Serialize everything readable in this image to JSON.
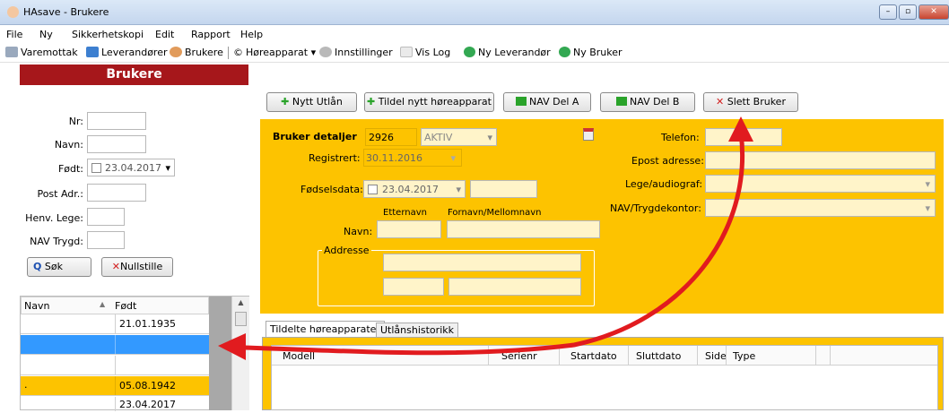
{
  "window": {
    "title": "HAsave - Brukere",
    "min": "–",
    "max": "▫",
    "close": "✕"
  },
  "menu": [
    "File",
    "Ny",
    "Sikkerhetskopi",
    "Edit",
    "Rapport",
    "Help"
  ],
  "toolbar": {
    "varemottak": "Varemottak",
    "leverandorer": "Leverandører",
    "brukere": "Brukere",
    "horeapparat": "Høreapparat",
    "innstillinger": "Innstillinger",
    "vislog": "Vis Log",
    "ny_leverandor": "Ny Leverandør",
    "ny_bruker": "Ny Bruker"
  },
  "search": {
    "header": "Brukere",
    "nr_label": "Nr:",
    "navn_label": "Navn:",
    "fodt_label": "Født:",
    "fodt_value": "23.04.2017",
    "post_label": "Post Adr.:",
    "lege_label": "Henv. Lege:",
    "nav_label": "NAV Trygd:",
    "sok_button": "Søk",
    "nullstille_button": "Nullstille"
  },
  "user_list": {
    "columns": [
      "Navn",
      "Født"
    ],
    "rows": [
      {
        "navn": "",
        "fodt": "21.01.1935"
      },
      {
        "navn": "",
        "fodt": ""
      },
      {
        "navn": "",
        "fodt": ""
      },
      {
        "navn": ".",
        "fodt": "05.08.1942"
      },
      {
        "navn": "",
        "fodt": "23.04.2017"
      }
    ]
  },
  "actions": {
    "nytt_utlan": "Nytt Utlån",
    "tildel": "Tildel nytt høreapparat",
    "nav_del_a": "NAV Del A",
    "nav_del_b": "NAV Del B",
    "slett_bruker": "Slett Bruker"
  },
  "details": {
    "title": "Bruker detaljer",
    "id": "2926",
    "status": "AKTIV",
    "registrert_label": "Registrert:",
    "registrert_value": "30.11.2016",
    "fodselsdata_label": "Fødselsdata:",
    "fodselsdata_value": "23.04.2017",
    "etternavn_label": "Etternavn",
    "fornavn_label": "Fornavn/Mellomnavn",
    "navn_label": "Navn:",
    "adresse_label": "Addresse",
    "telefon_label": "Telefon:",
    "epost_label": "Epost adresse:",
    "lege_label": "Lege/audiograf:",
    "nav_label": "NAV/Trygdekontor:"
  },
  "tabs": [
    "Tildelte høreapparater",
    "Utlånshistorikk"
  ],
  "devices": {
    "columns": [
      "Modell",
      "Serienr",
      "Startdato",
      "Sluttdato",
      "Side",
      "Type"
    ]
  },
  "colors": {
    "accent_yellow": "#fdc300",
    "header_red": "#a6171b",
    "selection_blue": "#3399ff",
    "arrow_red": "#e11b1f"
  }
}
